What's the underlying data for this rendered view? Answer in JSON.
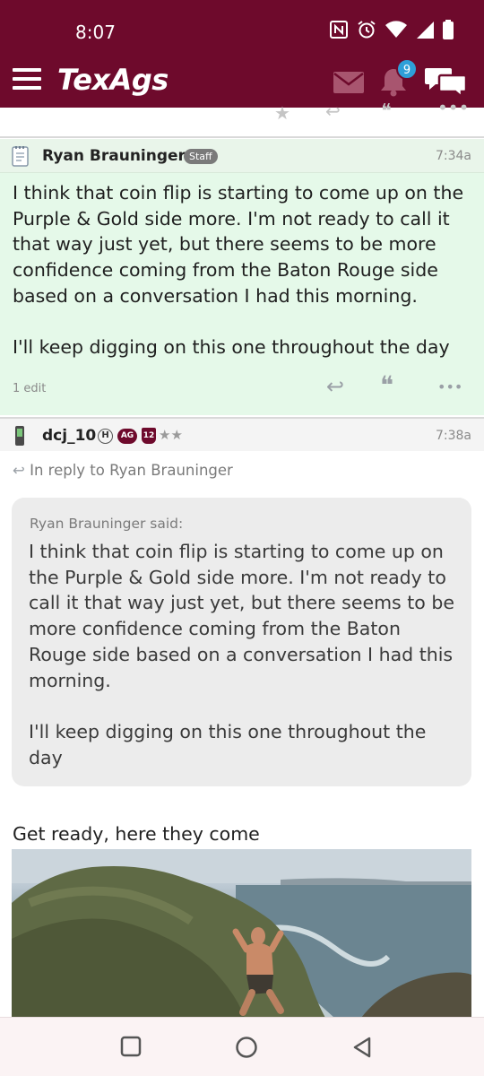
{
  "status_bar": {
    "time": "8:07",
    "icons": [
      "nfc-icon",
      "alarm-icon",
      "wifi-icon",
      "signal-icon",
      "battery-icon"
    ]
  },
  "app_bar": {
    "logo_text": "TexAgs",
    "notification_count": "9",
    "colors": {
      "brand": "#6e0a2c",
      "badge": "#2e9fd8"
    }
  },
  "post1": {
    "author": "Ryan Brauninger",
    "role_badge": "Staff",
    "time": "7:34a",
    "body": "I think that coin flip is starting to come up on the Purple & Gold side more. I'm not ready to call it that way just yet, but there seems to be more confidence coming from the Baton Rouge side based on a conversation I had this morning.\n\nI'll keep digging on this one throughout the day",
    "edit_note": "1 edit",
    "background": "#e5f9e9"
  },
  "post2": {
    "author": "dcj_10",
    "badges": [
      "H",
      "AG",
      "12"
    ],
    "stars": "★★",
    "time": "7:38a",
    "reply_to": "In reply to Ryan Brauninger",
    "quote_said": "Ryan Brauninger said:",
    "quote_text": "I think that coin flip is starting to come up on the Purple & Gold side more. I'm not ready to call it that way just yet, but there seems to be more confidence coming from the Baton Rouge side based on a conversation I had this morning.\n\nI'll keep digging on this one throughout the day",
    "text": "Get ready, here they come"
  }
}
